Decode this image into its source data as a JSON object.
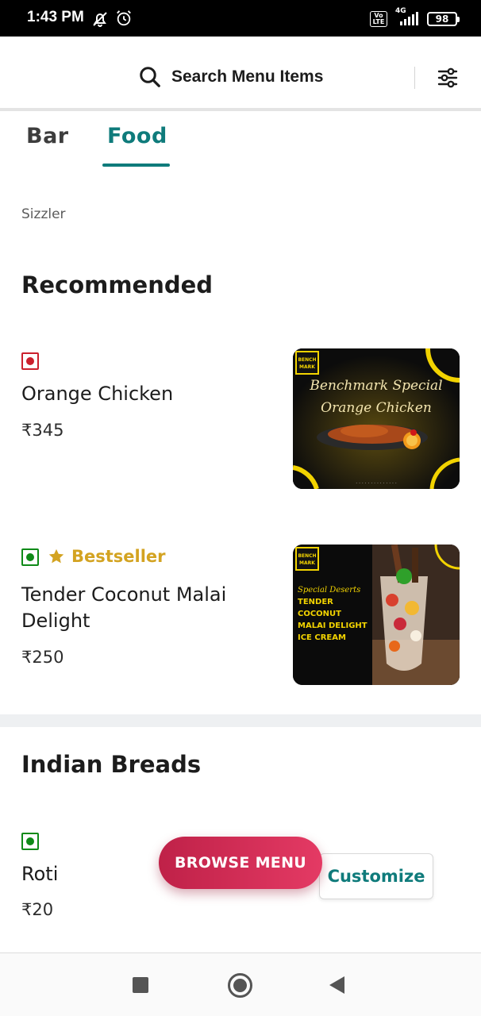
{
  "status_bar": {
    "time": "1:43 PM",
    "network": "4G",
    "volte": "Vo LTE",
    "battery": "98"
  },
  "header": {
    "search_label": "Search Menu Items"
  },
  "tabs": [
    {
      "label": "Bar"
    },
    {
      "label": "Food"
    }
  ],
  "category": "Sizzler",
  "sections": [
    {
      "title": "Recommended",
      "items": [
        {
          "name": "Orange Chicken",
          "price": "₹345",
          "diet": "non-veg",
          "image": {
            "brand": "BENCH MARK",
            "caption_1": "Benchmark Special",
            "caption_2": "Orange Chicken"
          }
        },
        {
          "name": "Tender Coconut Malai Delight",
          "price": "₹250",
          "diet": "veg",
          "badge": "Bestseller",
          "image": {
            "brand": "BENCH MARK",
            "caption_1": "Special Deserts",
            "caption_2": "TENDER COCONUT MALAI DELIGHT ICE CREAM"
          }
        }
      ]
    },
    {
      "title": "Indian Breads",
      "items": [
        {
          "name": "Roti",
          "price": "₹20",
          "diet": "veg",
          "action": "Customize"
        }
      ]
    }
  ],
  "browse_menu_label": "BROWSE MENU",
  "colors": {
    "accent": "#0f7b7b",
    "nonveg": "#cb202d",
    "veg": "#0f8a18",
    "bestseller": "#d3a321",
    "browse": "#d52c57"
  }
}
